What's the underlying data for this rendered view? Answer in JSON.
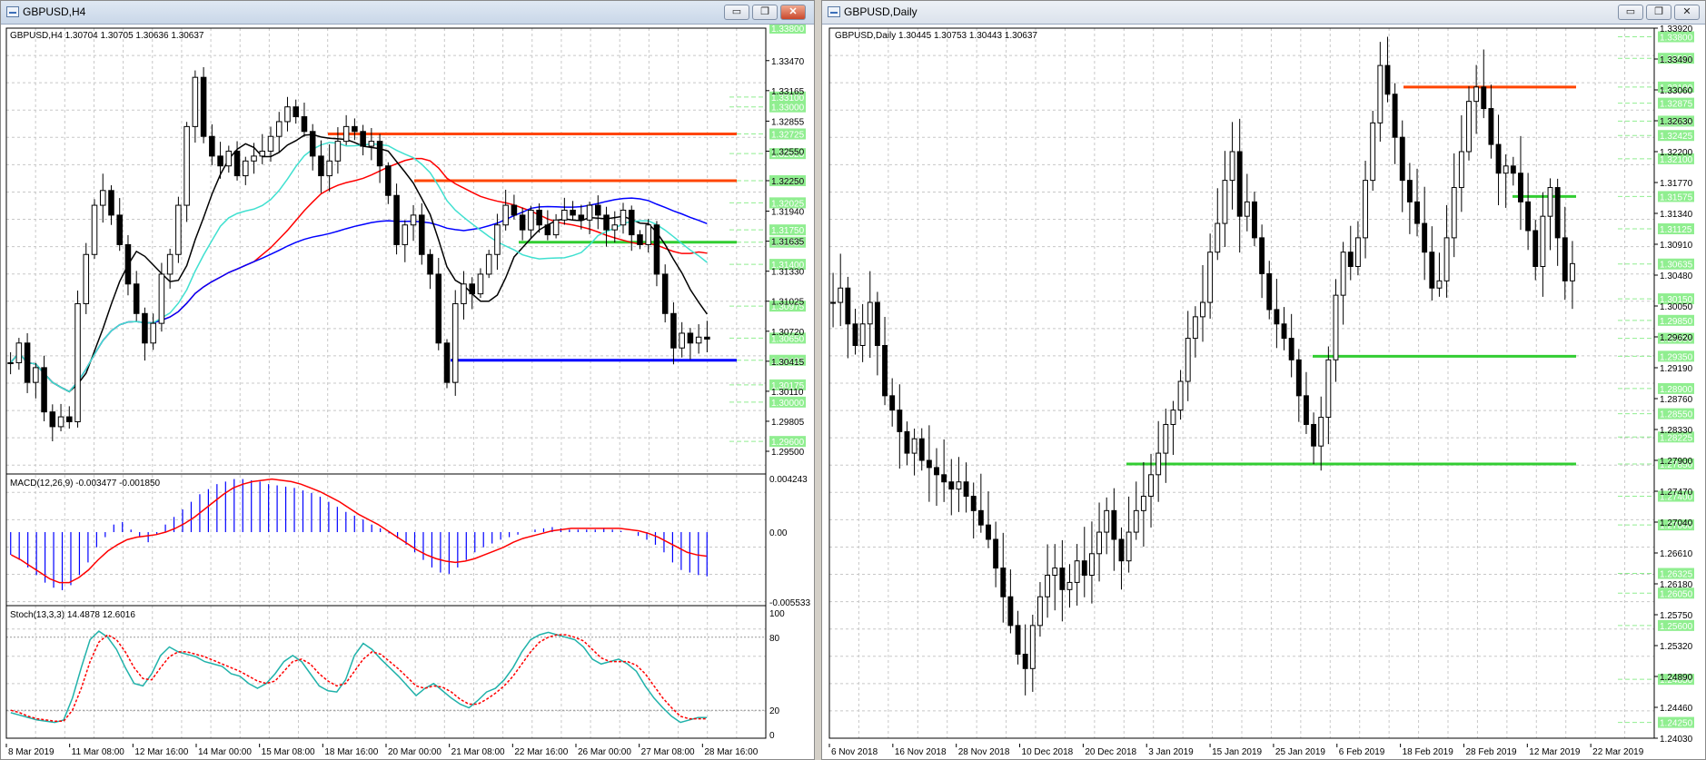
{
  "left_window": {
    "title": "GBPUSD,H4",
    "buttons": {
      "minimize": "▭",
      "restore": "❐",
      "close": "✕"
    },
    "price_header": "GBPUSD,H4  1.30704 1.30705 1.30636 1.30637",
    "macd_header": "MACD(12,26,9) -0.003477 -0.001850",
    "stoch_header": "Stoch(13,3,3) 14.4878 12.6016",
    "price_axis": [
      "1.33470",
      "1.33165",
      "1.32855",
      "1.32550",
      "1.32250",
      "1.31940",
      "1.31635",
      "1.31330",
      "1.31025",
      "1.30720",
      "1.30415",
      "1.30110",
      "1.29805",
      "1.29500"
    ],
    "price_level_tags": [
      "1.33800",
      "1.33100",
      "1.33000",
      "1.32725",
      "1.32525",
      "1.32250",
      "1.32025",
      "1.31750",
      "1.31625",
      "1.31400",
      "1.30975",
      "1.30650",
      "1.30425",
      "1.30175",
      "1.30000",
      "1.29600"
    ],
    "macd_axis": [
      "0.004243",
      "0.00",
      "-0.005533"
    ],
    "stoch_axis": [
      "100",
      "80",
      "20",
      "0"
    ],
    "time_axis": [
      "8 Mar 2019",
      "11 Mar 08:00",
      "12 Mar 16:00",
      "14 Mar 00:00",
      "15 Mar 08:00",
      "18 Mar 16:00",
      "20 Mar 00:00",
      "21 Mar 08:00",
      "22 Mar 16:00",
      "26 Mar 00:00",
      "27 Mar 08:00",
      "28 Mar 16:00"
    ]
  },
  "right_window": {
    "title": "GBPUSD,Daily",
    "buttons": {
      "minimize": "▭",
      "restore": "❐",
      "close": "✕"
    },
    "price_header": "GBPUSD,Daily  1.30445 1.30753 1.30443 1.30637",
    "price_axis": [
      "1.33920",
      "1.33490",
      "1.33060",
      "1.32630",
      "1.32200",
      "1.31770",
      "1.31340",
      "1.30910",
      "1.30480",
      "1.30050",
      "1.29620",
      "1.29190",
      "1.28760",
      "1.28330",
      "1.27900",
      "1.27470",
      "1.27040",
      "1.26610",
      "1.26180",
      "1.25750",
      "1.25320",
      "1.24890",
      "1.24460",
      "1.24030"
    ],
    "price_level_tags": [
      "1.33800",
      "1.33500",
      "1.33100",
      "1.32875",
      "1.32625",
      "1.32425",
      "1.32100",
      "1.31575",
      "1.31125",
      "1.30635",
      "1.30150",
      "1.29850",
      "1.29600",
      "1.29350",
      "1.28900",
      "1.28550",
      "1.28225",
      "1.27850",
      "1.27400",
      "1.27000",
      "1.26325",
      "1.26050",
      "1.25600",
      "1.24850",
      "1.24250"
    ],
    "time_axis": [
      "6 Nov 2018",
      "16 Nov 2018",
      "28 Nov 2018",
      "10 Dec 2018",
      "20 Dec 2018",
      "3 Jan 2019",
      "15 Jan 2019",
      "25 Jan 2019",
      "6 Feb 2019",
      "18 Feb 2019",
      "28 Feb 2019",
      "12 Mar 2019",
      "22 Mar 2019"
    ]
  },
  "colors": {
    "up_candle": "#ffffff",
    "down_candle": "#000000",
    "resistance": "#ff4500",
    "support_green": "#32cd32",
    "support_blue": "#0000ff",
    "ma_red": "#ff0000",
    "ma_blue": "#0000ff",
    "ma_black": "#000000",
    "ma_aqua": "#40e0d0",
    "macd_hist": "#0000ff",
    "macd_signal": "#ff0000",
    "stoch_main": "#20b2aa",
    "stoch_signal": "#ff0000",
    "level_tag": "#90ee90",
    "grid": "#c8c8c8"
  },
  "chart_data": [
    {
      "type": "candlestick",
      "title": "GBPUSD,H4",
      "open": 1.30704,
      "high": 1.30705,
      "low": 1.30636,
      "close": 1.30637,
      "ylim": [
        1.295,
        1.338
      ],
      "x_labels": [
        "8 Mar 2019",
        "11 Mar 08:00",
        "12 Mar 16:00",
        "14 Mar 00:00",
        "15 Mar 08:00",
        "18 Mar 16:00",
        "20 Mar 00:00",
        "21 Mar 08:00",
        "22 Mar 16:00",
        "26 Mar 00:00",
        "27 Mar 08:00",
        "28 Mar 16:00"
      ],
      "closes": [
        1.304,
        1.306,
        1.302,
        1.3035,
        1.299,
        1.2975,
        1.2985,
        1.298,
        1.31,
        1.315,
        1.32,
        1.3215,
        1.319,
        1.316,
        1.312,
        1.309,
        1.306,
        1.308,
        1.313,
        1.315,
        1.32,
        1.328,
        1.333,
        1.327,
        1.325,
        1.324,
        1.3255,
        1.323,
        1.3245,
        1.325,
        1.3255,
        1.327,
        1.3285,
        1.33,
        1.329,
        1.3275,
        1.325,
        1.323,
        1.3245,
        1.3265,
        1.328,
        1.3275,
        1.326,
        1.3265,
        1.324,
        1.321,
        1.316,
        1.318,
        1.319,
        1.315,
        1.313,
        1.306,
        1.302,
        1.31,
        1.312,
        1.311,
        1.313,
        1.315,
        1.318,
        1.32,
        1.319,
        1.3175,
        1.3195,
        1.318,
        1.317,
        1.3185,
        1.3195,
        1.319,
        1.3185,
        1.32,
        1.319,
        1.3175,
        1.318,
        1.3195,
        1.317,
        1.316,
        1.318,
        1.313,
        1.309,
        1.3055,
        1.307,
        1.306,
        1.3066,
        1.3064
      ],
      "levels": {
        "resistance": [
          1.32725,
          1.3225
        ],
        "support_green": [
          1.31625
        ],
        "support_blue": [
          1.30425
        ]
      },
      "moving_averages": [
        "red",
        "blue",
        "black",
        "aqua"
      ]
    },
    {
      "type": "bar",
      "title": "MACD(12,26,9) -0.003477 -0.001850",
      "ylim": [
        -0.005533,
        0.004243
      ],
      "histogram": [
        -0.0018,
        -0.0022,
        -0.0028,
        -0.0034,
        -0.004,
        -0.0044,
        -0.0046,
        -0.0042,
        -0.0034,
        -0.0024,
        -0.0012,
        -0.0004,
        0.0006,
        0.0008,
        0.0002,
        -0.0004,
        -0.0008,
        -0.0002,
        0.0006,
        0.0012,
        0.0018,
        0.0024,
        0.003,
        0.0034,
        0.0038,
        0.004,
        0.0042,
        0.0042,
        0.0041,
        0.004,
        0.0038,
        0.0037,
        0.0036,
        0.0035,
        0.0033,
        0.0031,
        0.0028,
        0.0024,
        0.002,
        0.0016,
        0.0013,
        0.001,
        0.0006,
        0.0003,
        -0.0001,
        -0.0005,
        -0.001,
        -0.0016,
        -0.0022,
        -0.0028,
        -0.0032,
        -0.0033,
        -0.0028,
        -0.0022,
        -0.0016,
        -0.0012,
        -0.0009,
        -0.0006,
        -0.0004,
        -0.0002,
        0.0,
        0.0002,
        0.0003,
        0.0004,
        0.0003,
        0.0002,
        0.0002,
        0.0002,
        0.0002,
        0.0003,
        0.0002,
        0.0001,
        0.0,
        -0.0003,
        -0.0006,
        -0.001,
        -0.0016,
        -0.0024,
        -0.003,
        -0.0032,
        -0.0034,
        -0.0035
      ],
      "signal": [
        -0.0018,
        -0.0022,
        -0.0027,
        -0.0032,
        -0.0037,
        -0.004,
        -0.004,
        -0.0036,
        -0.003,
        -0.0022,
        -0.0015,
        -0.001,
        -0.0006,
        -0.0004,
        -0.0003,
        -0.0002,
        0.0,
        0.0003,
        0.0007,
        0.0012,
        0.0018,
        0.0024,
        0.003,
        0.0035,
        0.0038,
        0.004,
        0.0041,
        0.0042,
        0.0041,
        0.004,
        0.0038,
        0.0035,
        0.0032,
        0.0028,
        0.0024,
        0.0019,
        0.0014,
        0.001,
        0.0006,
        0.0001,
        -0.0004,
        -0.0009,
        -0.0014,
        -0.0018,
        -0.0021,
        -0.0023,
        -0.0024,
        -0.0023,
        -0.0021,
        -0.0018,
        -0.0015,
        -0.0012,
        -0.0008,
        -0.0005,
        -0.0003,
        -0.0001,
        0.0001,
        0.0002,
        0.0003,
        0.0003,
        0.0003,
        0.0003,
        0.0003,
        0.0003,
        0.0002,
        0.0001,
        -0.0001,
        -0.0004,
        -0.0008,
        -0.0012,
        -0.0016,
        -0.0018,
        -0.0019
      ]
    },
    {
      "type": "line",
      "title": "Stoch(13,3,3) 14.4878 12.6016",
      "ylim": [
        0,
        100
      ],
      "main": [
        18,
        16,
        14,
        12,
        11,
        10,
        12,
        30,
        55,
        78,
        85,
        80,
        70,
        55,
        42,
        40,
        50,
        65,
        72,
        68,
        66,
        64,
        60,
        58,
        56,
        50,
        48,
        42,
        38,
        42,
        50,
        60,
        65,
        60,
        50,
        40,
        36,
        35,
        45,
        65,
        75,
        70,
        62,
        55,
        48,
        40,
        32,
        38,
        42,
        36,
        30,
        25,
        22,
        28,
        35,
        38,
        45,
        55,
        68,
        78,
        82,
        84,
        82,
        80,
        78,
        72,
        62,
        58,
        60,
        62,
        58,
        52,
        40,
        30,
        22,
        15,
        10,
        12,
        14,
        14
      ],
      "signal": [
        20,
        18,
        15,
        13,
        12,
        11,
        11,
        20,
        38,
        60,
        76,
        82,
        78,
        68,
        55,
        46,
        45,
        55,
        64,
        68,
        68,
        66,
        64,
        61,
        58,
        55,
        52,
        48,
        44,
        42,
        44,
        52,
        60,
        62,
        58,
        50,
        44,
        40,
        42,
        52,
        62,
        68,
        66,
        60,
        54,
        47,
        40,
        38,
        40,
        39,
        35,
        29,
        25,
        25,
        29,
        34,
        40,
        48,
        58,
        68,
        76,
        80,
        82,
        82,
        80,
        77,
        70,
        63,
        60,
        60,
        60,
        57,
        50,
        40,
        30,
        22,
        15,
        13,
        13,
        13
      ]
    },
    {
      "type": "candlestick",
      "title": "GBPUSD,Daily",
      "open": 1.30445,
      "high": 1.30753,
      "low": 1.30443,
      "close": 1.30637,
      "ylim": [
        1.2403,
        1.3392
      ],
      "x_labels": [
        "6 Nov 2018",
        "16 Nov 2018",
        "28 Nov 2018",
        "10 Dec 2018",
        "20 Dec 2018",
        "3 Jan 2019",
        "15 Jan 2019",
        "25 Jan 2019",
        "6 Feb 2019",
        "18 Feb 2019",
        "28 Feb 2019",
        "12 Mar 2019",
        "22 Mar 2019"
      ],
      "closes": [
        1.301,
        1.303,
        1.298,
        1.295,
        1.298,
        1.301,
        1.295,
        1.288,
        1.286,
        1.283,
        1.28,
        1.282,
        1.279,
        1.278,
        1.277,
        1.276,
        1.275,
        1.276,
        1.274,
        1.272,
        1.27,
        1.268,
        1.264,
        1.26,
        1.256,
        1.252,
        1.25,
        1.256,
        1.26,
        1.263,
        1.264,
        1.261,
        1.262,
        1.265,
        1.263,
        1.266,
        1.269,
        1.272,
        1.268,
        1.265,
        1.269,
        1.272,
        1.274,
        1.277,
        1.28,
        1.284,
        1.286,
        1.29,
        1.296,
        1.299,
        1.301,
        1.308,
        1.312,
        1.318,
        1.322,
        1.313,
        1.315,
        1.31,
        1.305,
        1.3,
        1.298,
        1.296,
        1.293,
        1.288,
        1.284,
        1.281,
        1.285,
        1.293,
        1.302,
        1.308,
        1.306,
        1.31,
        1.318,
        1.326,
        1.334,
        1.33,
        1.324,
        1.318,
        1.315,
        1.312,
        1.308,
        1.303,
        1.304,
        1.31,
        1.317,
        1.322,
        1.329,
        1.331,
        1.328,
        1.323,
        1.319,
        1.32,
        1.319,
        1.315,
        1.311,
        1.306,
        1.313,
        1.317,
        1.31,
        1.304,
        1.3064
      ],
      "levels": {
        "resistance": [
          1.331
        ],
        "support_green": [
          1.31575,
          1.2935,
          1.2785
        ]
      }
    }
  ]
}
